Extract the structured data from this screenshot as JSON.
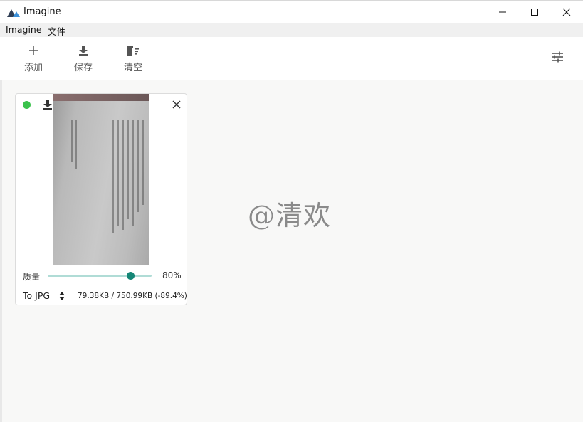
{
  "window": {
    "title": "Imagine",
    "logo_icon": "mountain-logo-icon",
    "controls": [
      "minimize-icon",
      "maximize-icon",
      "close-icon"
    ]
  },
  "menu": {
    "items": [
      {
        "label": "Imagine"
      },
      {
        "label": "文件"
      }
    ]
  },
  "toolbar": {
    "add_label": "添加",
    "save_label": "保存",
    "clear_label": "清空",
    "settings_icon": "sliders-icon"
  },
  "card": {
    "status_color": "#3ac24c",
    "quality_label": "质量",
    "quality_value": "80%",
    "quality_fraction": 0.8,
    "slider_color": "#158676",
    "format_label": "To JPG",
    "size_info": "79.38KB / 750.99KB (-89.4%)"
  },
  "watermark": {
    "text": "@清欢"
  }
}
